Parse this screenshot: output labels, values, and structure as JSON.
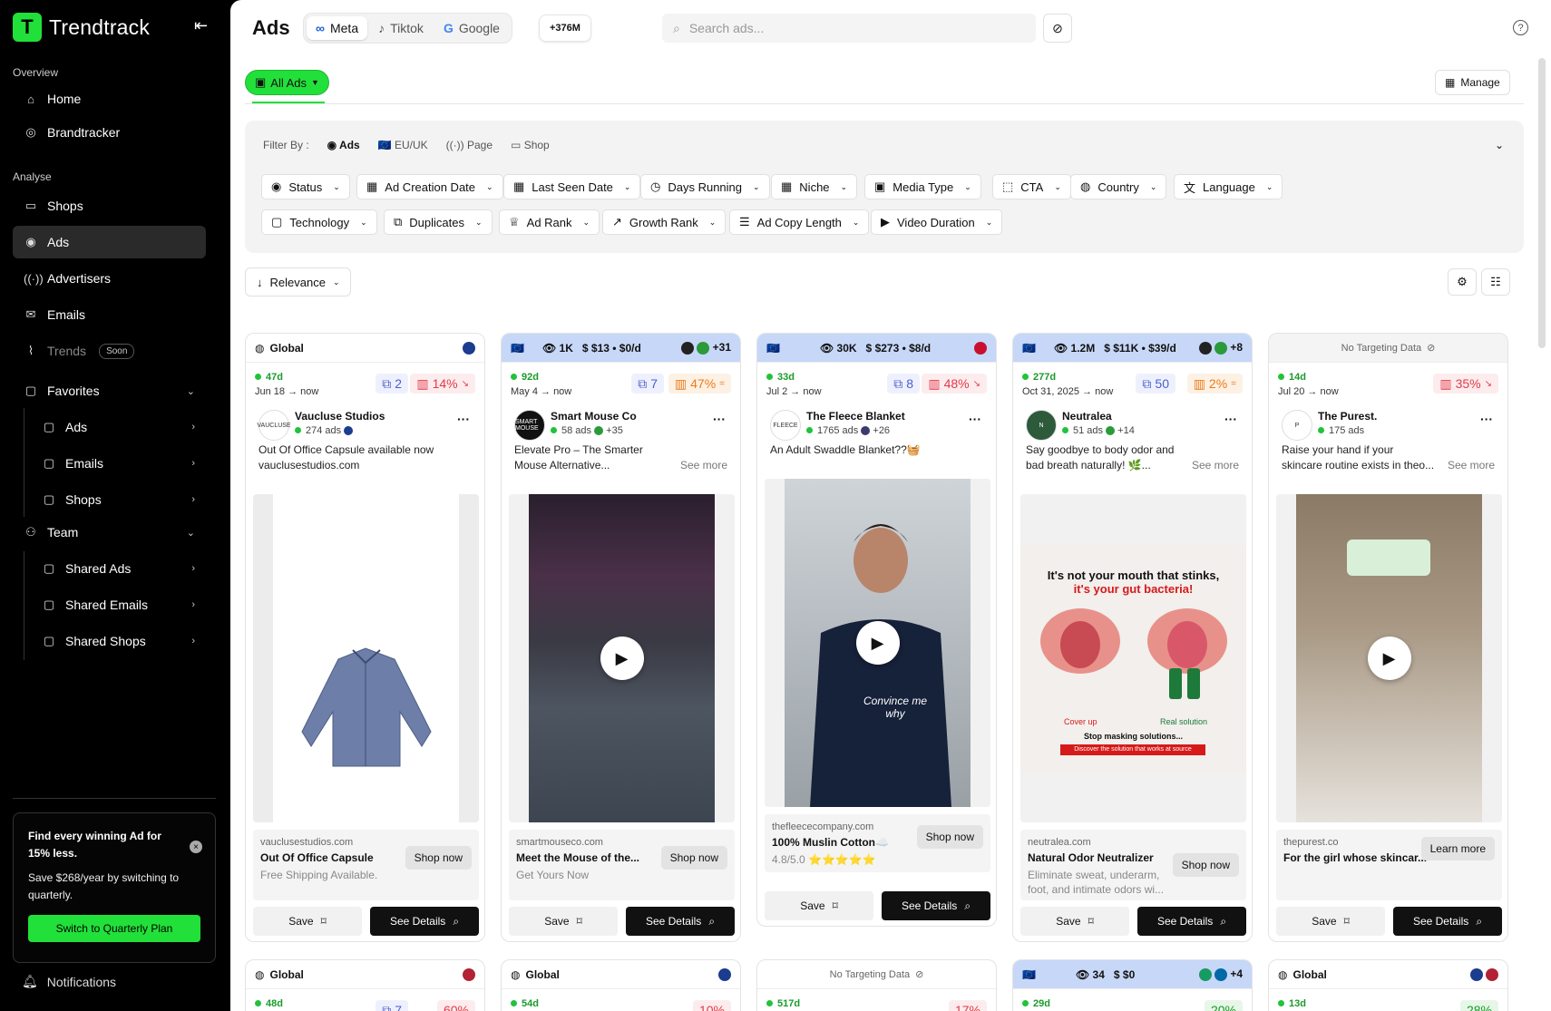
{
  "sidebar": {
    "brand": "Trendtrack",
    "overview_label": "Overview",
    "analyse_label": "Analyse",
    "items": {
      "home": "Home",
      "brandtracker": "Brandtracker",
      "shops": "Shops",
      "ads": "Ads",
      "advertisers": "Advertisers",
      "emails": "Emails",
      "trends": "Trends",
      "soon": "Soon",
      "favorites": "Favorites",
      "fav_ads": "Ads",
      "fav_emails": "Emails",
      "fav_shops": "Shops",
      "team": "Team",
      "shared_ads": "Shared Ads",
      "shared_emails": "Shared Emails",
      "shared_shops": "Shared Shops"
    },
    "promo": {
      "title": "Find every winning Ad for 15% less.",
      "text": "Save $268/year by switching to quarterly.",
      "button": "Switch to Quarterly Plan"
    },
    "notifications": "Notifications"
  },
  "header": {
    "title": "Ads",
    "platforms": [
      "Meta",
      "Tiktok",
      "Google"
    ],
    "count": "+376M",
    "search_placeholder": "Search ads..."
  },
  "toolbar": {
    "all_ads": "All Ads",
    "manage": "Manage",
    "relevance": "Relevance"
  },
  "filters": {
    "filter_by": "Filter By :",
    "tabs": [
      "Ads",
      "EU/UK",
      "Page",
      "Shop"
    ],
    "row1": [
      "Status",
      "Ad Creation Date",
      "Last Seen Date",
      "Days Running",
      "Niche",
      "Media Type",
      "CTA",
      "Country",
      "Language"
    ],
    "row2": [
      "Technology",
      "Duplicates",
      "Ad Rank",
      "Growth Rank",
      "Ad Copy Length",
      "Video Duration"
    ]
  },
  "cards": [
    {
      "top": "Global",
      "days": "47d",
      "dates": "Jun 18 → now",
      "dup": "2",
      "growth": "14%",
      "growth_color": "red",
      "name": "Vaucluse Studios",
      "ads": "274 ads",
      "copy1": "Out Of Office Capsule available now",
      "copy2": "vauclusestudios.com",
      "domain": "vauclusestudios.com",
      "headline": "Out Of Office Capsule",
      "desc": "Free Shipping Available.",
      "cta": "Shop now",
      "save": "Save",
      "details": "See Details",
      "avatar": "VAUCLUSE"
    },
    {
      "top_views": "1K",
      "top_spend": "$13 • $0/d",
      "top_more": "+31",
      "days": "92d",
      "dates": "May 4 → now",
      "dup": "7",
      "growth": "47%",
      "growth_color": "org",
      "name": "Smart Mouse Co",
      "ads": "58 ads",
      "ads_more": "+35",
      "copy1": "Elevate Pro – The Smarter",
      "copy2": "Mouse Alternative...",
      "see_more": "See more",
      "domain": "smartmouseco.com",
      "headline": "Meet the Mouse of the...",
      "desc": "Get Yours Now",
      "cta": "Shop now",
      "save": "Save",
      "details": "See Details",
      "avatar": "SMART MOUSE"
    },
    {
      "top_views": "30K",
      "top_spend": "$273 • $8/d",
      "days": "33d",
      "dates": "Jul 2 → now",
      "dup": "8",
      "growth": "48%",
      "growth_color": "red",
      "name": "The Fleece Blanket",
      "ads": "1765 ads",
      "ads_more": "+26",
      "copy1": "An Adult Swaddle Blanket??🧺",
      "domain": "thefleececompany.com",
      "headline": "100% Muslin Cotton☁️",
      "desc": "4.8/5.0 ⭐⭐⭐⭐⭐",
      "cta": "Shop now",
      "save": "Save",
      "details": "See Details",
      "video_text": "Convince me why",
      "avatar": "FLEECE"
    },
    {
      "top_views": "1.2M",
      "top_spend": "$11K • $39/d",
      "top_more": "+8",
      "days": "277d",
      "dates": "Oct 31, 2025 → now",
      "dup": "50",
      "growth": "2%",
      "growth_color": "org",
      "name": "Neutralea",
      "ads": "51 ads",
      "ads_more": "+14",
      "copy1": "Say goodbye to body odor and",
      "copy2": "bad breath naturally! 🌿...",
      "see_more": "See more",
      "domain": "neutralea.com",
      "headline": "Natural Odor Neutralizer",
      "desc": "Eliminate sweat, underarm, foot, and intimate odors wi...",
      "cta": "Shop now",
      "save": "Save",
      "details": "See Details",
      "img_t1": "It's not your mouth that stinks,",
      "img_t2": "it's your gut bacteria!",
      "img_l1": "Cover up",
      "img_l2": "Real solution",
      "img_b1": "Stop masking solutions...",
      "img_b2": "Discover the solution that works at source",
      "avatar": "N"
    },
    {
      "top": "No Targeting Data",
      "days": "14d",
      "dates": "Jul 20 → now",
      "growth": "35%",
      "growth_color": "red",
      "name": "The Purest.",
      "ads": "175 ads",
      "copy1": "Raise your hand if your",
      "copy2": "skincare routine exists in theo...",
      "see_more": "See more",
      "domain": "thepurest.co",
      "headline": "For the girl whose skincar...",
      "cta": "Learn more",
      "save": "Save",
      "details": "See Details",
      "avatar": "P"
    }
  ],
  "cards_row2": [
    {
      "top": "Global",
      "days": "48d",
      "dup": "7",
      "growth": "60%"
    },
    {
      "top": "Global",
      "days": "54d",
      "growth": "10%"
    },
    {
      "top": "No Targeting Data",
      "days": "517d",
      "growth": "17%"
    },
    {
      "top_views": "34",
      "top_spend": "$0",
      "top_more": "+4",
      "days": "29d",
      "growth": "20%"
    },
    {
      "top": "Global",
      "days": "13d",
      "growth": "28%"
    }
  ]
}
